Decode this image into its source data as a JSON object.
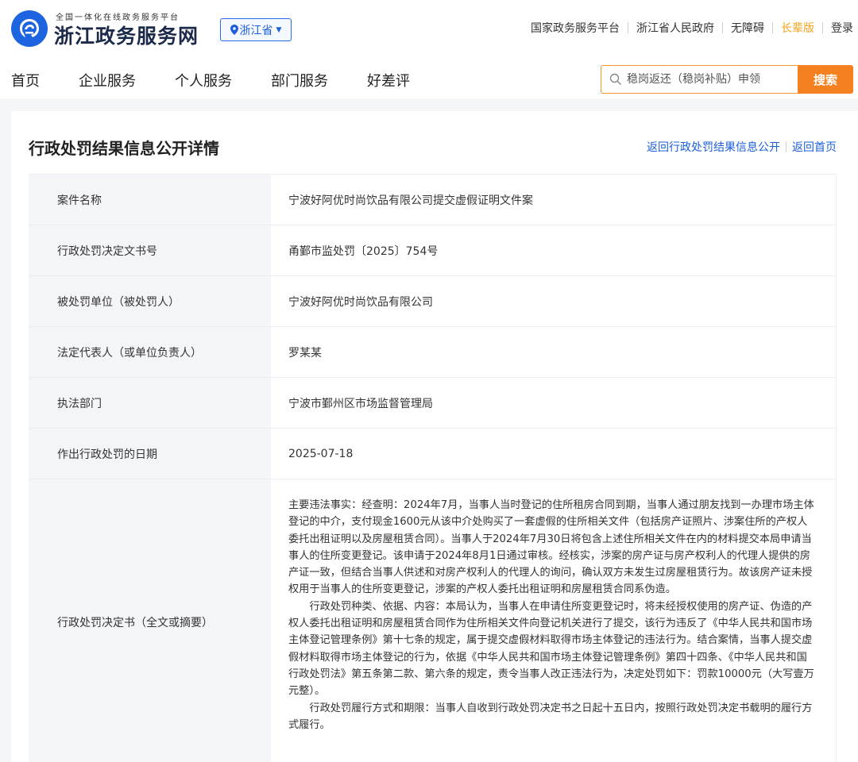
{
  "header": {
    "logo_tagline": "全国一体化在线政务服务平台",
    "logo_title": "浙江政务服务网",
    "region": "浙江省",
    "top_links": [
      {
        "label": "国家政务服务平台",
        "highlight": false
      },
      {
        "label": "浙江省人民政府",
        "highlight": false
      },
      {
        "label": "无障碍",
        "highlight": false
      },
      {
        "label": "长辈版",
        "highlight": true
      },
      {
        "label": "登录",
        "highlight": false
      }
    ],
    "nav": [
      "首页",
      "企业服务",
      "个人服务",
      "部门服务",
      "好差评"
    ],
    "search": {
      "placeholder": "稳岗返还（稳岗补贴）申领",
      "button": "搜索"
    }
  },
  "page": {
    "title": "行政处罚结果信息公开详情",
    "back_link": "返回行政处罚结果信息公开",
    "home_link": "返回首页"
  },
  "details": [
    {
      "label": "案件名称",
      "value": "宁波好阿优时尚饮品有限公司提交虚假证明文件案"
    },
    {
      "label": "行政处罚决定文书号",
      "value": "甬鄞市监处罚〔2025〕754号"
    },
    {
      "label": "被处罚单位（被处罚人）",
      "value": "宁波好阿优时尚饮品有限公司"
    },
    {
      "label": "法定代表人（或单位负责人）",
      "value": "罗某某"
    },
    {
      "label": "执法部门",
      "value": "宁波市鄞州区市场监督管理局"
    },
    {
      "label": "作出行政处罚的日期",
      "value": "2025-07-18"
    }
  ],
  "decision": {
    "label": "行政处罚决定书（全文或摘要）",
    "paragraphs": [
      "主要违法事实：经查明：2024年7月，当事人当时登记的住所租房合同到期，当事人通过朋友找到一办理市场主体登记的中介，支付现金1600元从该中介处购买了一套虚假的住所相关文件（包括房产证照片、涉案住所的产权人委托出租证明以及房屋租赁合同）。当事人于2024年7月30日将包含上述住所相关文件在内的材料提交本局申请当事人的住所变更登记。该申请于2024年8月1日通过审核。经核实，涉案的房产证与房产权利人的代理人提供的房产证一致，但结合当事人供述和对房产权利人的代理人的询问，确认双方未发生过房屋租赁行为。故该房产证未授权用于当事人的住所变更登记，涉案的产权人委托出租证明和房屋租赁合同系伪造。",
      "行政处罚种类、依据、内容：本局认为，当事人在申请住所变更登记时，将未经授权使用的房产证、伪造的产权人委托出租证明和房屋租赁合同作为住所相关文件向登记机关进行了提交，该行为违反了《中华人民共和国市场主体登记管理条例》第十七条的规定，属于提交虚假材料取得市场主体登记的违法行为。结合案情，当事人提交虚假材料取得市场主体登记的行为，依据《中华人民共和国市场主体登记管理条例》第四十四条、《中华人民共和国行政处罚法》第五条第二款、第六条的规定，责令当事人改正违法行为，决定处罚如下：罚款10000元（大写壹万元整）。",
      "行政处罚履行方式和期限：当事人自收到行政处罚决定书之日起十五日内，按照行政处罚决定书载明的履行方式履行。"
    ]
  }
}
